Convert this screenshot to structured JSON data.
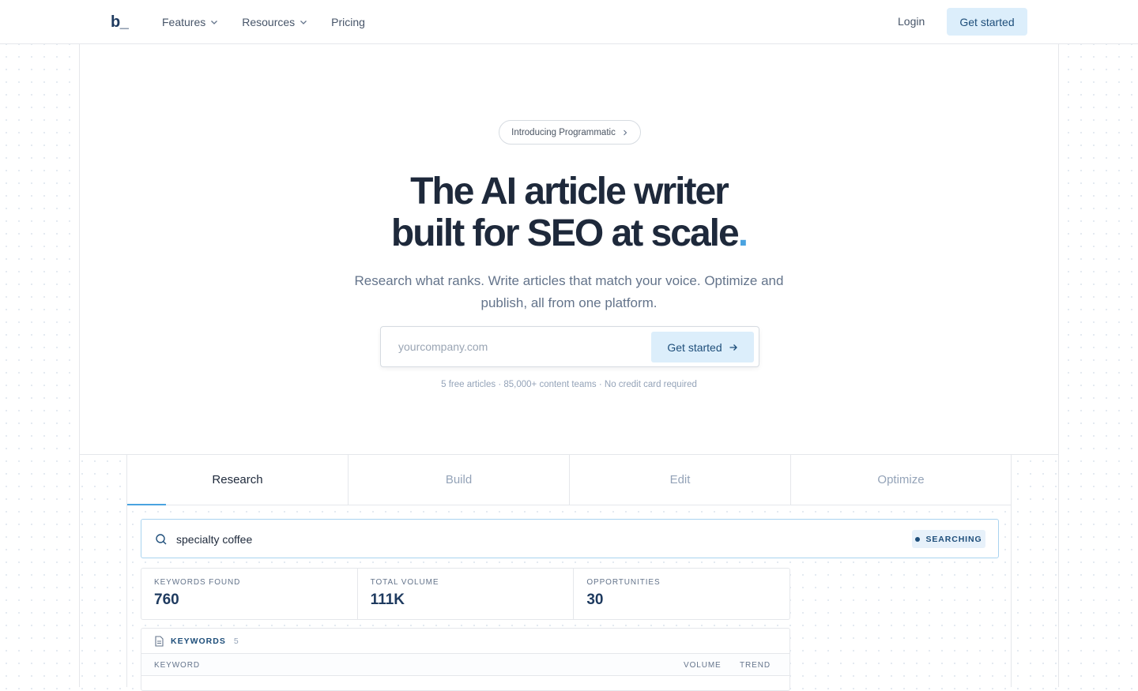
{
  "header": {
    "logo": "b_",
    "nav": [
      {
        "label": "Features",
        "has_dropdown": true
      },
      {
        "label": "Resources",
        "has_dropdown": true
      },
      {
        "label": "Pricing",
        "has_dropdown": false
      }
    ],
    "login_label": "Login",
    "cta_label": "Get started"
  },
  "hero": {
    "pill_label": "Introducing Programmatic",
    "headline_line1": "The AI article writer",
    "headline_line2": "built for SEO at scale",
    "headline_dot": ".",
    "subheadline": "Research what ranks. Write articles that match your voice. Optimize and publish, all from one platform.",
    "email_placeholder": "yourcompany.com",
    "email_value": "",
    "signup_button": "Get started",
    "fine_print": "5 free articles · 85,000+ content teams · No credit card required"
  },
  "demo": {
    "tabs": [
      {
        "label": "Research",
        "active": true
      },
      {
        "label": "Build",
        "active": false
      },
      {
        "label": "Edit",
        "active": false
      },
      {
        "label": "Optimize",
        "active": false
      }
    ],
    "search_query": "specialty coffee",
    "status_badge": "SEARCHING",
    "stats": [
      {
        "label": "KEYWORDS FOUND",
        "value": "760"
      },
      {
        "label": "TOTAL VOLUME",
        "value": "111K"
      },
      {
        "label": "OPPORTUNITIES",
        "value": "30"
      }
    ],
    "keywords_panel": {
      "title": "KEYWORDS",
      "count": "5",
      "columns": [
        "KEYWORD",
        "VOLUME",
        "TREND"
      ]
    }
  },
  "colors": {
    "accent": "#4aa3e0",
    "brand_dark": "#1e3a5f",
    "cta_bg": "#dceefb",
    "cta_text": "#1e4e7a"
  },
  "icons": [
    "chevron-down-icon",
    "chevron-right-icon",
    "arrow-right-icon",
    "search-icon",
    "document-icon"
  ]
}
